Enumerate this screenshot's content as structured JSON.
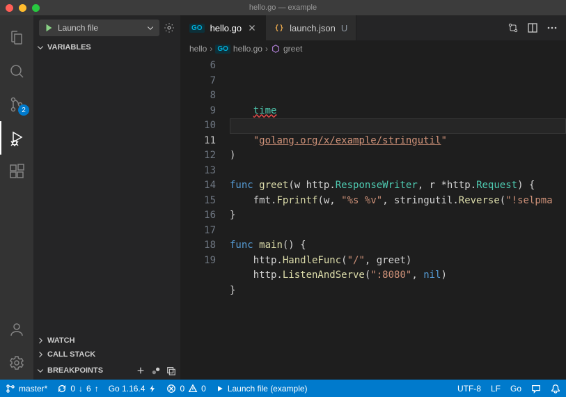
{
  "window_title": "hello.go — example",
  "source_control_badge": "2",
  "launch_config": "Launch file",
  "sidebar": {
    "variables": "VARIABLES",
    "watch": "WATCH",
    "call_stack": "CALL STACK",
    "breakpoints": "BREAKPOINTS"
  },
  "tabs": [
    {
      "name": "hello.go",
      "active": true,
      "status": ""
    },
    {
      "name": "launch.json",
      "active": false,
      "status": "U"
    }
  ],
  "breadcrumb": {
    "folder": "hello",
    "file": "hello.go",
    "symbol": "greet"
  },
  "code": {
    "first_line_number": 6,
    "lines": [
      {
        "n": 6,
        "segs": [
          {
            "t": "    ",
            "c": ""
          },
          {
            "t": "time",
            "c": "tok-type err-underline"
          }
        ]
      },
      {
        "n": 7,
        "segs": []
      },
      {
        "n": 8,
        "segs": [
          {
            "t": "    ",
            "c": ""
          },
          {
            "t": "\"",
            "c": "tok-str"
          },
          {
            "t": "golang.org/x/example/stringutil",
            "c": "tok-str underline-link"
          },
          {
            "t": "\"",
            "c": "tok-str"
          }
        ]
      },
      {
        "n": 9,
        "segs": [
          {
            "t": ")",
            "c": ""
          }
        ]
      },
      {
        "n": 10,
        "segs": []
      },
      {
        "n": 11,
        "active": true,
        "segs": [
          {
            "t": "func ",
            "c": "tok-kw"
          },
          {
            "t": "greet",
            "c": "tok-fn"
          },
          {
            "t": "(w http.",
            "c": ""
          },
          {
            "t": "ResponseWriter",
            "c": "tok-type"
          },
          {
            "t": ", r *http.",
            "c": ""
          },
          {
            "t": "Request",
            "c": "tok-type"
          },
          {
            "t": ") {",
            "c": ""
          }
        ]
      },
      {
        "n": 12,
        "segs": [
          {
            "t": "    fmt.",
            "c": ""
          },
          {
            "t": "Fprintf",
            "c": "tok-fn"
          },
          {
            "t": "(w, ",
            "c": ""
          },
          {
            "t": "\"%s %v\"",
            "c": "tok-str"
          },
          {
            "t": ", stringutil.",
            "c": ""
          },
          {
            "t": "Reverse",
            "c": "tok-fn"
          },
          {
            "t": "(",
            "c": ""
          },
          {
            "t": "\"!selpma",
            "c": "tok-str"
          }
        ]
      },
      {
        "n": 13,
        "segs": [
          {
            "t": "}",
            "c": ""
          }
        ]
      },
      {
        "n": 14,
        "segs": []
      },
      {
        "n": 15,
        "segs": [
          {
            "t": "func ",
            "c": "tok-kw"
          },
          {
            "t": "main",
            "c": "tok-fn"
          },
          {
            "t": "() {",
            "c": ""
          }
        ]
      },
      {
        "n": 16,
        "segs": [
          {
            "t": "    http.",
            "c": ""
          },
          {
            "t": "HandleFunc",
            "c": "tok-fn"
          },
          {
            "t": "(",
            "c": ""
          },
          {
            "t": "\"/\"",
            "c": "tok-str"
          },
          {
            "t": ", greet)",
            "c": ""
          }
        ]
      },
      {
        "n": 17,
        "segs": [
          {
            "t": "    http.",
            "c": ""
          },
          {
            "t": "ListenAndServe",
            "c": "tok-fn"
          },
          {
            "t": "(",
            "c": ""
          },
          {
            "t": "\":8080\"",
            "c": "tok-str"
          },
          {
            "t": ", ",
            "c": ""
          },
          {
            "t": "nil",
            "c": "tok-nil"
          },
          {
            "t": ")",
            "c": ""
          }
        ]
      },
      {
        "n": 18,
        "segs": [
          {
            "t": "}",
            "c": ""
          }
        ]
      },
      {
        "n": 19,
        "segs": []
      }
    ]
  },
  "status": {
    "branch": "master*",
    "sync_down": "0",
    "sync_up": "6",
    "go_version": "Go 1.16.4",
    "errors": "0",
    "warnings": "0",
    "launch_config": "Launch file (example)",
    "encoding": "UTF-8",
    "eol": "LF",
    "language": "Go"
  }
}
